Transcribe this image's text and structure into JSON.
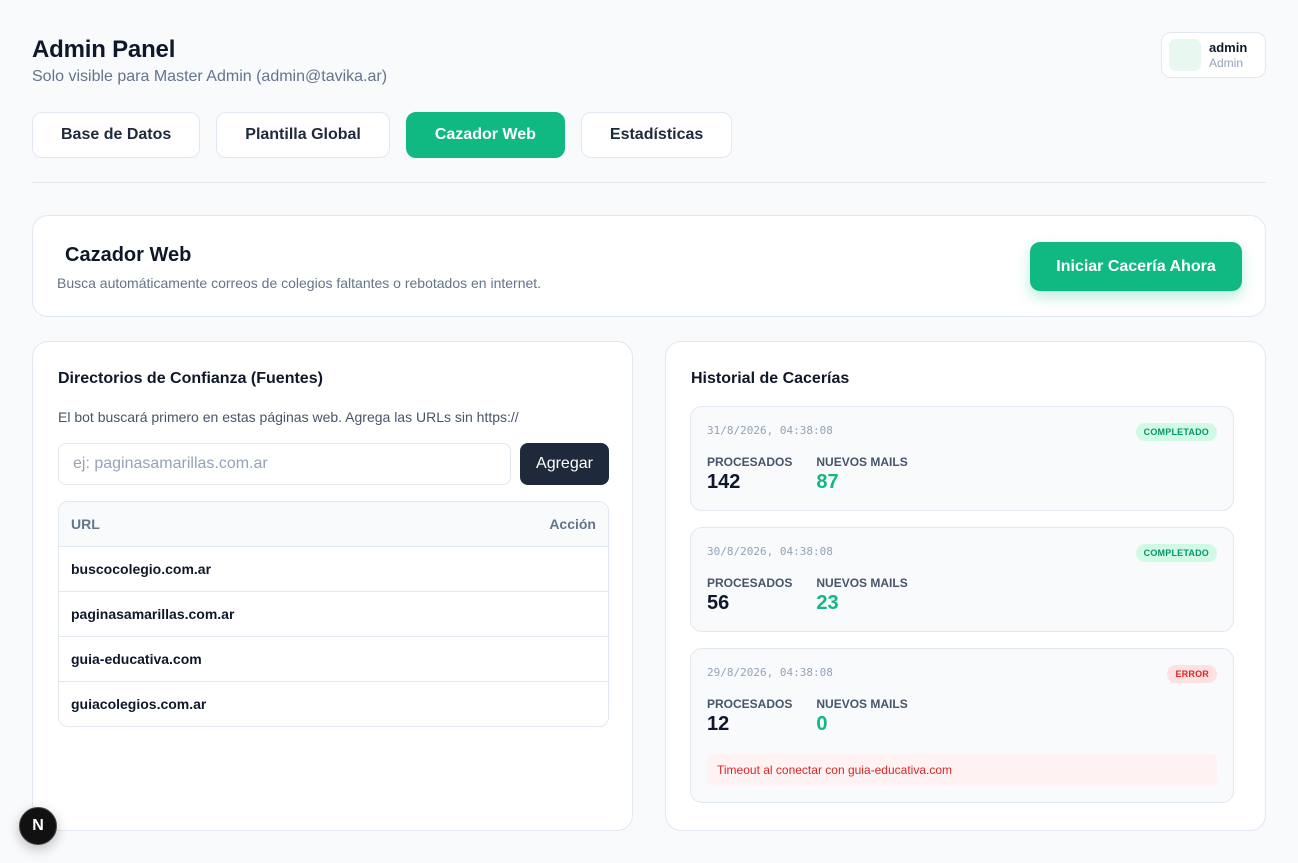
{
  "header": {
    "title": "Admin Panel",
    "subtitle": "Solo visible para Master Admin (admin@tavika.ar)"
  },
  "user": {
    "name": "admin",
    "role": "Admin"
  },
  "tabs": [
    {
      "label": "Base de Datos",
      "active": false
    },
    {
      "label": "Plantilla Global",
      "active": false
    },
    {
      "label": "Cazador Web",
      "active": true
    },
    {
      "label": "Estadísticas",
      "active": false
    }
  ],
  "hero": {
    "title": "Cazador Web",
    "description": "Busca automáticamente correos de colegios faltantes o rebotados en internet.",
    "cta_label": "Iniciar Cacería Ahora"
  },
  "sources": {
    "title": "Directorios de Confianza (Fuentes)",
    "hint": "El bot buscará primero en estas páginas web. Agrega las URLs sin https://",
    "input_placeholder": "ej: paginasamarillas.com.ar",
    "input_value": "",
    "add_label": "Agregar",
    "columns": {
      "url": "URL",
      "action": "Acción"
    },
    "rows": [
      {
        "url": "buscocolegio.com.ar"
      },
      {
        "url": "paginasamarillas.com.ar"
      },
      {
        "url": "guia-educativa.com"
      },
      {
        "url": "guiacolegios.com.ar"
      }
    ]
  },
  "history": {
    "title": "Historial de Cacerías",
    "items": [
      {
        "timestamp": "31/8/2026, 04:38:08",
        "status": "COMPLETADO",
        "status_type": "ok",
        "processed_label": "PROCESADOS",
        "processed": "142",
        "new_label": "NUEVOS MAILS",
        "new": "87",
        "error": ""
      },
      {
        "timestamp": "30/8/2026, 04:38:08",
        "status": "COMPLETADO",
        "status_type": "ok",
        "processed_label": "PROCESADOS",
        "processed": "56",
        "new_label": "NUEVOS MAILS",
        "new": "23",
        "error": ""
      },
      {
        "timestamp": "29/8/2026, 04:38:08",
        "status": "ERROR",
        "status_type": "err",
        "processed_label": "PROCESADOS",
        "processed": "12",
        "new_label": "NUEVOS MAILS",
        "new": "0",
        "error": "Timeout al conectar con guia-educativa.com"
      }
    ]
  },
  "dev_badge": "N",
  "colors": {
    "accent": "#10b981",
    "dark": "#1e293b",
    "error": "#dc2626",
    "background": "#f8fafc"
  }
}
